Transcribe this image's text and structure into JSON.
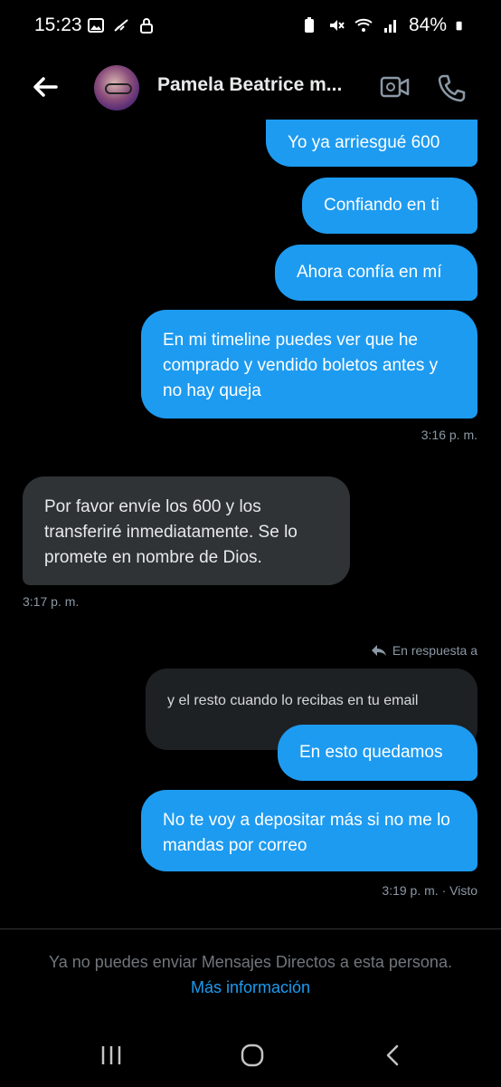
{
  "status_bar": {
    "time": "15:23",
    "battery": "84%"
  },
  "header": {
    "contact_name": "Pamela Beatrice m...",
    "back_icon": "arrow-left-icon",
    "video_icon": "video-call-icon",
    "phone_icon": "phone-icon"
  },
  "messages": [
    {
      "side": "out",
      "text": "Yo ya arriesgué 600"
    },
    {
      "side": "out",
      "text": "Confiando en ti"
    },
    {
      "side": "out",
      "text": "Ahora confía en mí"
    },
    {
      "side": "out",
      "text": "En mi timeline puedes ver que he comprado y vendido boletos antes y no hay queja"
    },
    {
      "side": "in",
      "text": "Por favor envíe los 600 y los transferiré inmediatamente. Se lo promete en nombre de Dios."
    },
    {
      "side": "out",
      "text": "En esto quedamos"
    },
    {
      "side": "out",
      "text": "No te voy a depositar más si no me lo mandas por correo"
    }
  ],
  "timestamps": {
    "t1": "3:16 p. m.",
    "t2": "3:17 p. m.",
    "t3": "3:19 p. m. · Visto"
  },
  "reply": {
    "label": "En respuesta a",
    "quoted_text": "y el resto cuando lo recibas en tu email"
  },
  "footer": {
    "notice": "Ya no puedes enviar Mensajes Directos a esta persona.",
    "link": "Más información"
  },
  "colors": {
    "accent": "#1d9bf0",
    "incoming_bubble": "#2f3336",
    "background": "#000000"
  }
}
